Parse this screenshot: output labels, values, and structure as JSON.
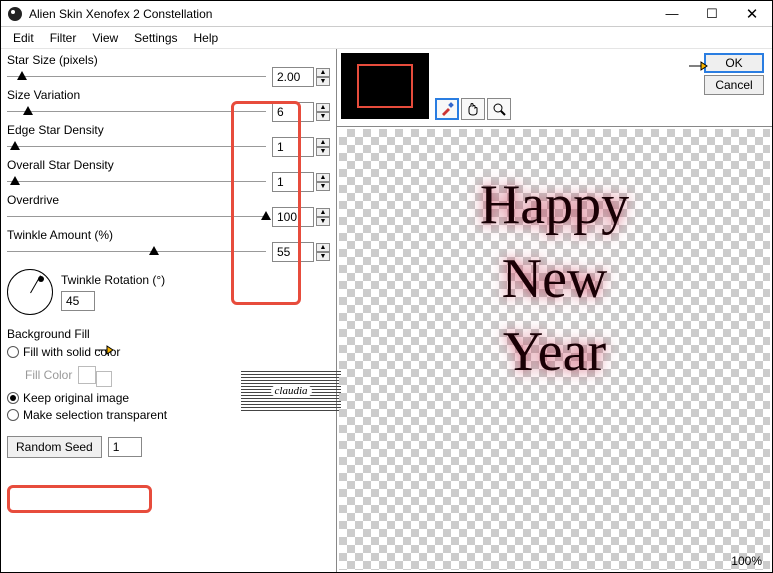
{
  "window": {
    "title": "Alien Skin Xenofex 2 Constellation"
  },
  "menu": {
    "items": [
      "Edit",
      "Filter",
      "View",
      "Settings",
      "Help"
    ]
  },
  "params": {
    "star_size": {
      "label": "Star Size (pixels)",
      "value": "2.00",
      "thumb_pct": 4
    },
    "size_variation": {
      "label": "Size Variation",
      "value": "6",
      "thumb_pct": 6
    },
    "edge_density": {
      "label": "Edge Star Density",
      "value": "1",
      "thumb_pct": 1
    },
    "overall_density": {
      "label": "Overall Star Density",
      "value": "1",
      "thumb_pct": 1
    },
    "overdrive": {
      "label": "Overdrive",
      "value": "100",
      "thumb_pct": 100
    },
    "twinkle_amount": {
      "label": "Twinkle Amount (%)",
      "value": "55",
      "thumb_pct": 55
    }
  },
  "twinkle_rotation": {
    "label": "Twinkle Rotation (°)",
    "value": "45"
  },
  "background_fill": {
    "header": "Background Fill",
    "fill_solid": "Fill with solid color",
    "fill_color_label": "Fill Color",
    "keep_original": "Keep original image",
    "make_transparent": "Make selection transparent"
  },
  "random_seed": {
    "button": "Random Seed",
    "value": "1"
  },
  "buttons": {
    "ok": "OK",
    "cancel": "Cancel"
  },
  "preview_text": {
    "line1": "Happy",
    "line2": "New",
    "line3": "Year"
  },
  "status": {
    "zoom": "100%"
  },
  "watermark": "claudia"
}
